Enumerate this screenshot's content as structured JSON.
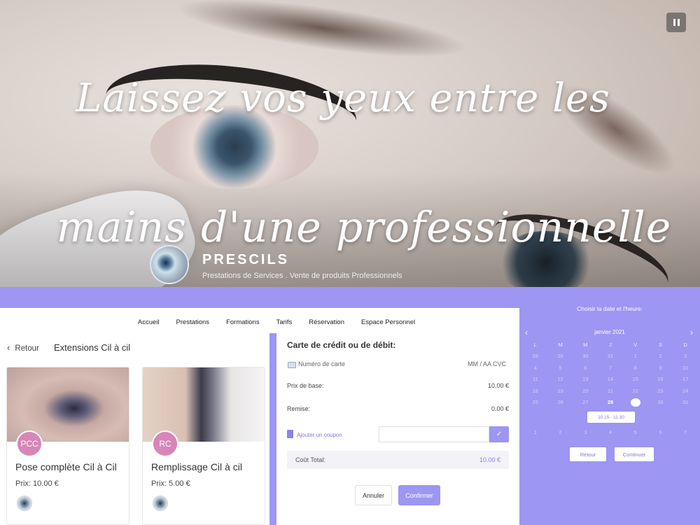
{
  "hero": {
    "title_line1": "Laissez vos yeux entre les",
    "title_line2": "mains d'une professionnelle",
    "brand_name": "PRESCILS",
    "brand_tagline": "Prestations de Services . Vente de produits Professionnels"
  },
  "nav": {
    "items": [
      "Accueil",
      "Prestations",
      "Formations",
      "Tarifs",
      "Réservation",
      "Espace Personnel"
    ]
  },
  "services_page": {
    "back_label": "Retour",
    "category": "Extensions Cil à cil",
    "services": [
      {
        "initials": "PCC",
        "name": "Pose complète Cil à Cil",
        "price": "Prix: 10.00 €"
      },
      {
        "initials": "RC",
        "name": "Remplissage Cil à cil",
        "price": "Prix: 5.00 €"
      }
    ]
  },
  "payment": {
    "title": "Carte de crédit ou de débit:",
    "card_number_placeholder": "Numéro de carte",
    "card_exp_placeholder": "MM / AA  CVC",
    "base_price_label": "Prix de base:",
    "base_price_value": "10.00 €",
    "discount_label": "Remise:",
    "discount_value": "0.00 €",
    "coupon_label": "Ajouter un coupon",
    "coupon_apply": "✓",
    "total_label": "Coût Total:",
    "total_value": "10.00 €",
    "cancel_label": "Annuler",
    "confirm_label": "Confirmer"
  },
  "calendar": {
    "title": "Choisir la date et l'heure:",
    "month": "janvier 2021",
    "weekdays": [
      "L",
      "M",
      "M",
      "J",
      "V",
      "S",
      "D"
    ],
    "weeks": [
      [
        "28",
        "29",
        "30",
        "31",
        "1",
        "2",
        "3"
      ],
      [
        "4",
        "5",
        "6",
        "7",
        "8",
        "9",
        "10"
      ],
      [
        "11",
        "12",
        "13",
        "14",
        "15",
        "16",
        "17"
      ],
      [
        "18",
        "19",
        "20",
        "21",
        "22",
        "23",
        "24"
      ],
      [
        "25",
        "26",
        "27",
        "28",
        "29",
        "30",
        "31"
      ]
    ],
    "last_week": [
      "1",
      "2",
      "3",
      "4",
      "5",
      "6",
      "7"
    ],
    "available_day": "28",
    "selected_day": "29",
    "time_slot": "10:15 - 11:30",
    "back_label": "Retour",
    "continue_label": "Continuer"
  }
}
